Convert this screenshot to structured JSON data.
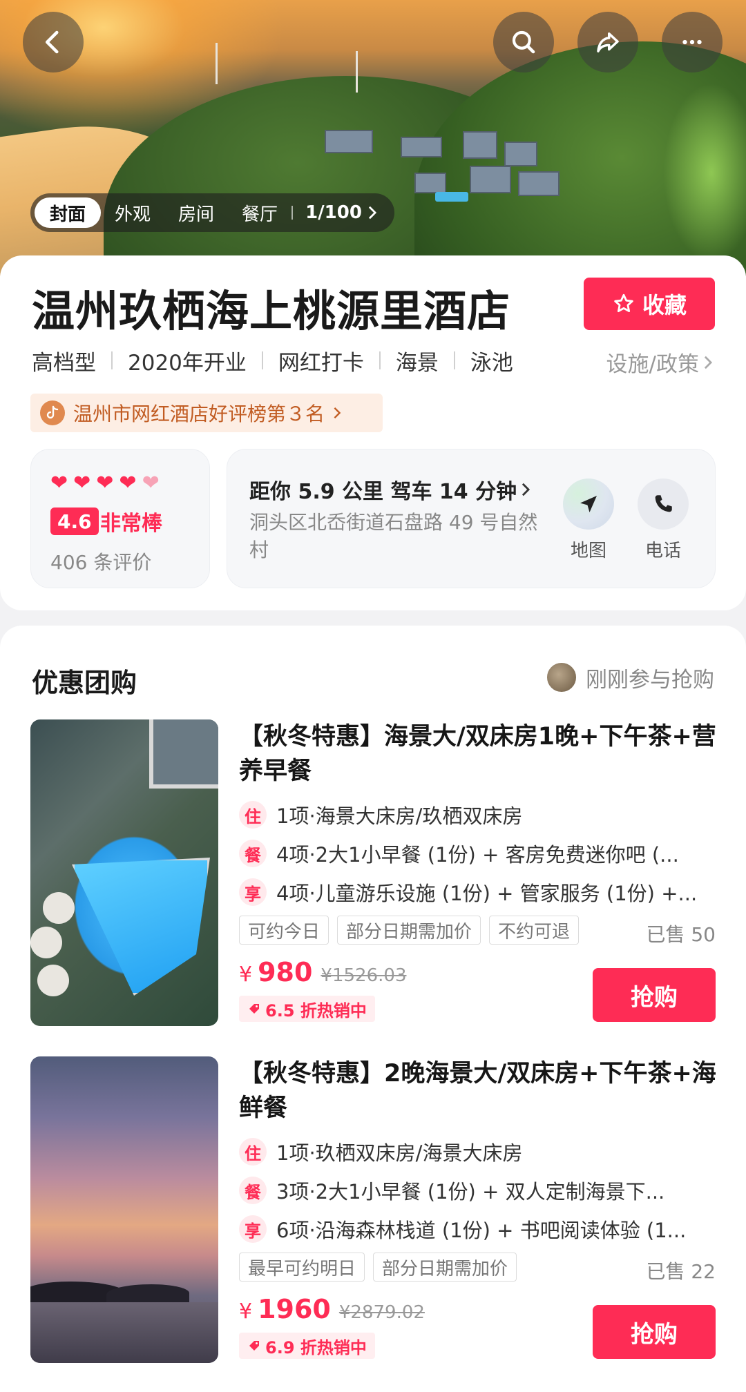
{
  "header": {
    "icons": [
      "back-arrow-icon",
      "search-icon",
      "share-icon",
      "more-icon"
    ],
    "photo_tabs": [
      "封面",
      "外观",
      "房间",
      "餐厅"
    ],
    "photo_count": "1/100"
  },
  "hotel": {
    "name": "温州玖栖海上桃源里酒店",
    "favorite_label": "收藏",
    "tags": [
      "高档型",
      "2020年开业",
      "网红打卡",
      "海景",
      "泳池"
    ],
    "policy_link": "设施/政策",
    "rank_text": "温州市网红酒店好评榜第３名"
  },
  "rating": {
    "hearts": 4.5,
    "score": "4.6",
    "score_text": "非常棒",
    "review_count": "406 条评价"
  },
  "location": {
    "distance": "距你 5.9 公里 驾车 14 分钟",
    "address": "洞头区北岙街道石盘路 49 号自然村",
    "map_label": "地图",
    "phone_label": "电话"
  },
  "deals": {
    "title": "优惠团购",
    "join_hint": "刚刚参与抢购",
    "items": [
      {
        "name": "【秋冬特惠】海景大/双床房1晚+下午茶+营养早餐",
        "features": [
          {
            "badge": "住",
            "text": "1项·海景大床房/玖栖双床房"
          },
          {
            "badge": "餐",
            "text": "4项·2大1小早餐 (1份) + 客房免费迷你吧 (..."
          },
          {
            "badge": "享",
            "text": "4项·儿童游乐设施 (1份) + 管家服务 (1份) +..."
          }
        ],
        "chips": [
          "可约今日",
          "部分日期需加价",
          "不约可退"
        ],
        "sold": "已售 50",
        "currency": "¥",
        "price": "980",
        "original_price": "¥1526.03",
        "discount": "6.5 折热销中",
        "buy_label": "抢购"
      },
      {
        "name": "【秋冬特惠】2晚海景大/双床房+下午茶+海鲜餐",
        "features": [
          {
            "badge": "住",
            "text": "1项·玖栖双床房/海景大床房"
          },
          {
            "badge": "餐",
            "text": "3项·2大1小早餐 (1份) + 双人定制海景下..."
          },
          {
            "badge": "享",
            "text": "6项·沿海森林栈道 (1份) + 书吧阅读体验 (1..."
          }
        ],
        "chips": [
          "最早可约明日",
          "部分日期需加价"
        ],
        "sold": "已售 22",
        "currency": "¥",
        "price": "1960",
        "original_price": "¥2879.02",
        "discount": "6.9 折热销中",
        "buy_label": "抢购"
      }
    ]
  },
  "colors": {
    "accent": "#fe2c55",
    "rank_text": "#c15c22",
    "muted": "#888888"
  }
}
